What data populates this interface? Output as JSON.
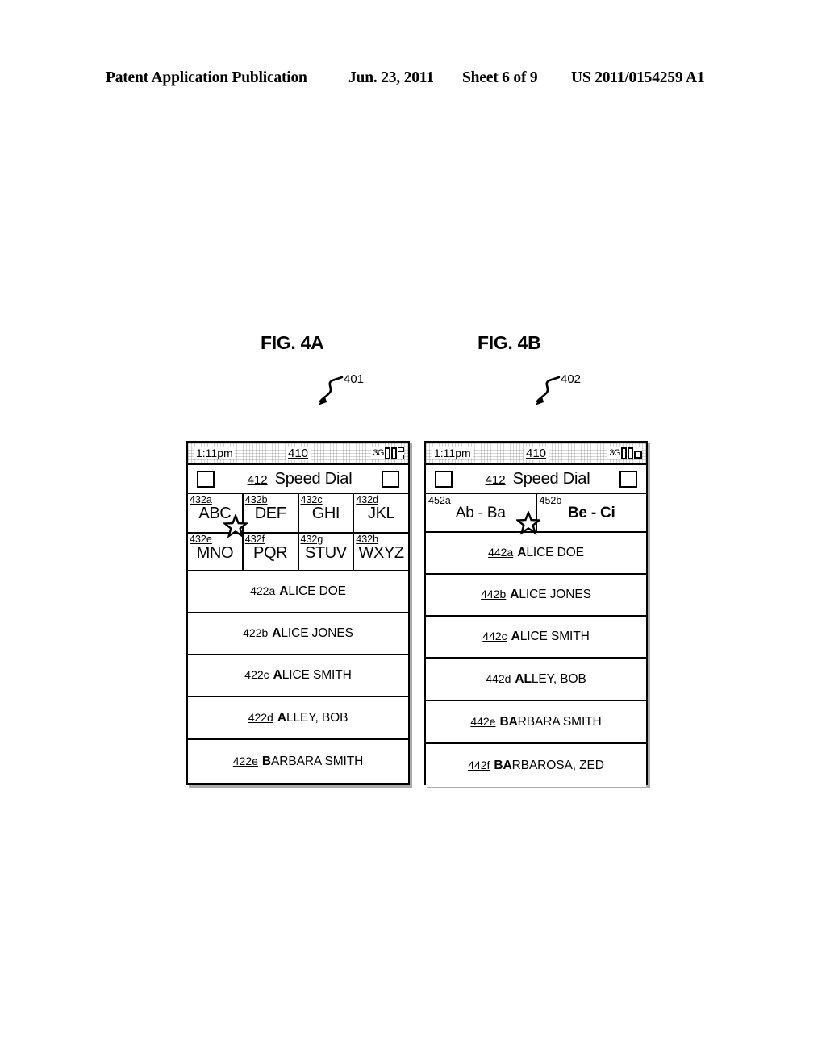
{
  "header": {
    "publication": "Patent Application Publication",
    "date": "Jun. 23, 2011",
    "sheet": "Sheet 6 of 9",
    "doc_number": "US 2011/0154259 A1"
  },
  "figures": [
    {
      "caption": "FIG. 4A",
      "callout_ref": "401",
      "status_bar": {
        "time": "1:11pm",
        "ref": "410",
        "network": "3G",
        "signal_icon": "signal-bars-icon"
      },
      "title_bar": {
        "left_box_icon": "checkbox-icon",
        "ref": "412",
        "label": "Speed Dial",
        "right_box_icon": "checkbox-icon"
      },
      "keypad": [
        {
          "ref": "432a",
          "label": "ABC",
          "selected": true
        },
        {
          "ref": "432b",
          "label": "DEF",
          "selected": false
        },
        {
          "ref": "432c",
          "label": "GHI",
          "selected": false
        },
        {
          "ref": "432d",
          "label": "JKL",
          "selected": false
        },
        {
          "ref": "432e",
          "label": "MNO",
          "selected": false
        },
        {
          "ref": "432f",
          "label": "PQR",
          "selected": false
        },
        {
          "ref": "432g",
          "label": "STUV",
          "selected": false
        },
        {
          "ref": "432h",
          "label": "WXYZ",
          "selected": false
        }
      ],
      "contacts": [
        {
          "ref": "422a",
          "bold": "A",
          "rest": "LICE DOE"
        },
        {
          "ref": "422b",
          "bold": "A",
          "rest": "LICE JONES"
        },
        {
          "ref": "422c",
          "bold": "A",
          "rest": "LICE SMITH"
        },
        {
          "ref": "422d",
          "bold": "A",
          "rest": "LLEY, BOB"
        },
        {
          "ref": "422e",
          "bold": "B",
          "rest": "ARBARA SMITH"
        }
      ]
    },
    {
      "caption": "FIG. 4B",
      "callout_ref": "402",
      "status_bar": {
        "time": "1:11pm",
        "ref": "410",
        "network": "3G",
        "signal_icon": "signal-bars-icon"
      },
      "title_bar": {
        "left_box_icon": "checkbox-icon",
        "ref": "412",
        "label": "Speed Dial",
        "right_box_icon": "checkbox-icon"
      },
      "ranges": [
        {
          "ref": "452a",
          "label": "Ab - Ba",
          "bold": false,
          "selected": true
        },
        {
          "ref": "452b",
          "label": "Be - Ci",
          "bold": true,
          "selected": false
        }
      ],
      "contacts": [
        {
          "ref": "442a",
          "bold": "A",
          "rest": "LICE DOE"
        },
        {
          "ref": "442b",
          "bold": "A",
          "rest": "LICE JONES"
        },
        {
          "ref": "442c",
          "bold": "A",
          "rest": "LICE SMITH"
        },
        {
          "ref": "442d",
          "bold": "AL",
          "rest": "LEY, BOB"
        },
        {
          "ref": "442e",
          "bold": "BA",
          "rest": "RBARA SMITH"
        },
        {
          "ref": "442f",
          "bold": "BA",
          "rest": "RBAROSA, ZED"
        }
      ]
    }
  ],
  "colors": {
    "ink": "#000000",
    "paper": "#ffffff"
  }
}
